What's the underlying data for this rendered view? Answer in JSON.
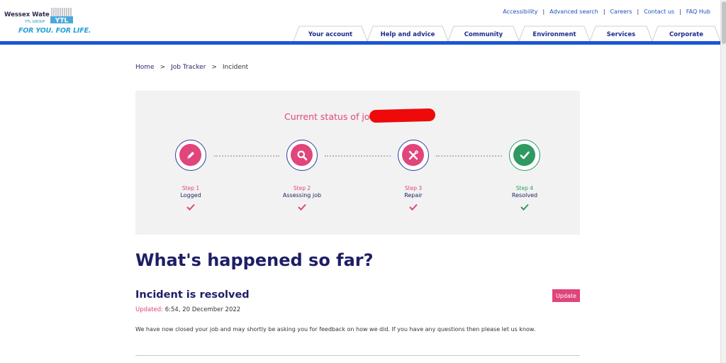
{
  "header": {
    "brand_name": "Wessex Water",
    "brand_group": "YTL GROUP",
    "brand_tagline": "FOR YOU. FOR LIFE.",
    "brand_mark": "YTL",
    "utility_links": [
      "Accessibility",
      "Advanced search",
      "Careers",
      "Contact us",
      "FAQ Hub"
    ],
    "nav_tabs": [
      "Your account",
      "Help and advice",
      "Community",
      "Environment",
      "Services",
      "Corporate"
    ]
  },
  "colors": {
    "accent_pink": "#e0457b",
    "nav_blue": "#1a56d6",
    "heading_navy": "#1e1e66",
    "done_green": "#2e9a62"
  },
  "breadcrumb": {
    "items": [
      "Home",
      "Job Tracker",
      "Incident"
    ],
    "separator": ">"
  },
  "status_panel": {
    "title": "Current status of job",
    "steps": [
      {
        "number": "Step 1",
        "name": "Logged",
        "icon": "pencil-icon",
        "state": "complete"
      },
      {
        "number": "Step 2",
        "name": "Assessing job",
        "icon": "magnifier-icon",
        "state": "complete"
      },
      {
        "number": "Step 3",
        "name": "Repair",
        "icon": "tools-icon",
        "state": "complete"
      },
      {
        "number": "Step 4",
        "name": "Resolved",
        "icon": "check-icon",
        "state": "resolved"
      }
    ]
  },
  "history": {
    "heading": "What's happened so far?",
    "entry_title": "Incident is resolved",
    "updated_label": "Updated:",
    "updated_value": "6:54, 20 December 2022",
    "update_button": "Update",
    "body": "We have now closed your job and may shortly be asking you for feedback on how we did. If you have any questions then please let us know."
  }
}
